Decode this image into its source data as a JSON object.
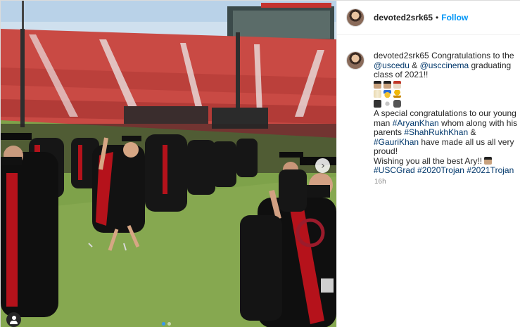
{
  "post": {
    "username": "devoted2srk65",
    "separator": "•",
    "follow_label": "Follow",
    "carousel": {
      "slides": 2,
      "active_index": 0
    },
    "next_icon": "chevron-right-icon",
    "tag_icon": "user-tag-icon"
  },
  "caption": {
    "username": "devoted2srk65",
    "t1": "Congratulations to the",
    "m1": "@uscedu",
    "t2": "&",
    "m2": "@usccinema",
    "t3": "graduating class of 2021!!",
    "emojis_line1": [
      "graduate",
      "graduate",
      "school"
    ],
    "emojis_line2": [
      "scroll",
      "medal",
      "trophy"
    ],
    "emojis_line3": [
      "clapper",
      "star",
      "backpack"
    ],
    "t4": "A special congratulations to our young man",
    "h1": "#AryanKhan",
    "t5": "whom along with his parents",
    "h2": "#ShahRukhKhan",
    "t6": "&",
    "h3": "#GauriKhan",
    "t7": "have made all us all very proud!",
    "t8": "Wishing you all the best Ary!!",
    "tags": [
      "#USCGrad",
      "#2020Trojan",
      "#2021Trojan"
    ],
    "time": "16h"
  },
  "colors": {
    "link": "#00376b",
    "follow": "#0095f6",
    "muted": "#8e8e8e",
    "gown": "#111111",
    "stole": "#b5121b",
    "turf": "#7ea24a",
    "seats": "#c23a3a"
  }
}
